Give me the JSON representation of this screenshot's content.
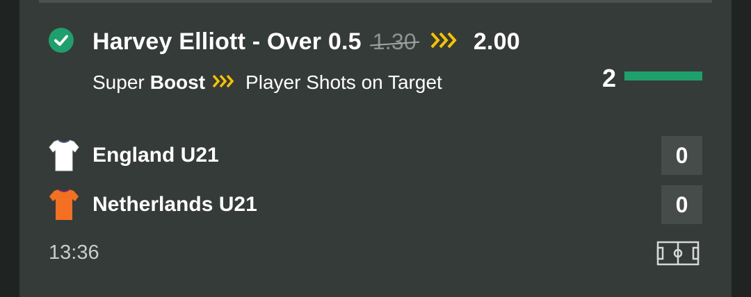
{
  "bet": {
    "selection": "Harvey Elliott - Over 0.5",
    "old_odds": "1.30",
    "new_odds": "2.00",
    "boost_prefix": "Super",
    "boost_word": "Boost",
    "market": "Player Shots on Target",
    "status_icon": "check-circle-icon",
    "accent_color": "#1e9f6b",
    "boost_color": "#f7c200"
  },
  "progress": {
    "value": "2",
    "fraction": 1.0
  },
  "match": {
    "teams": [
      {
        "name": "England U21",
        "score": "0",
        "shirt_color": "#ffffff"
      },
      {
        "name": "Netherlands U21",
        "score": "0",
        "shirt_color": "#f36f21"
      }
    ],
    "time": "13:36",
    "pitch_icon": "football-pitch-icon"
  }
}
